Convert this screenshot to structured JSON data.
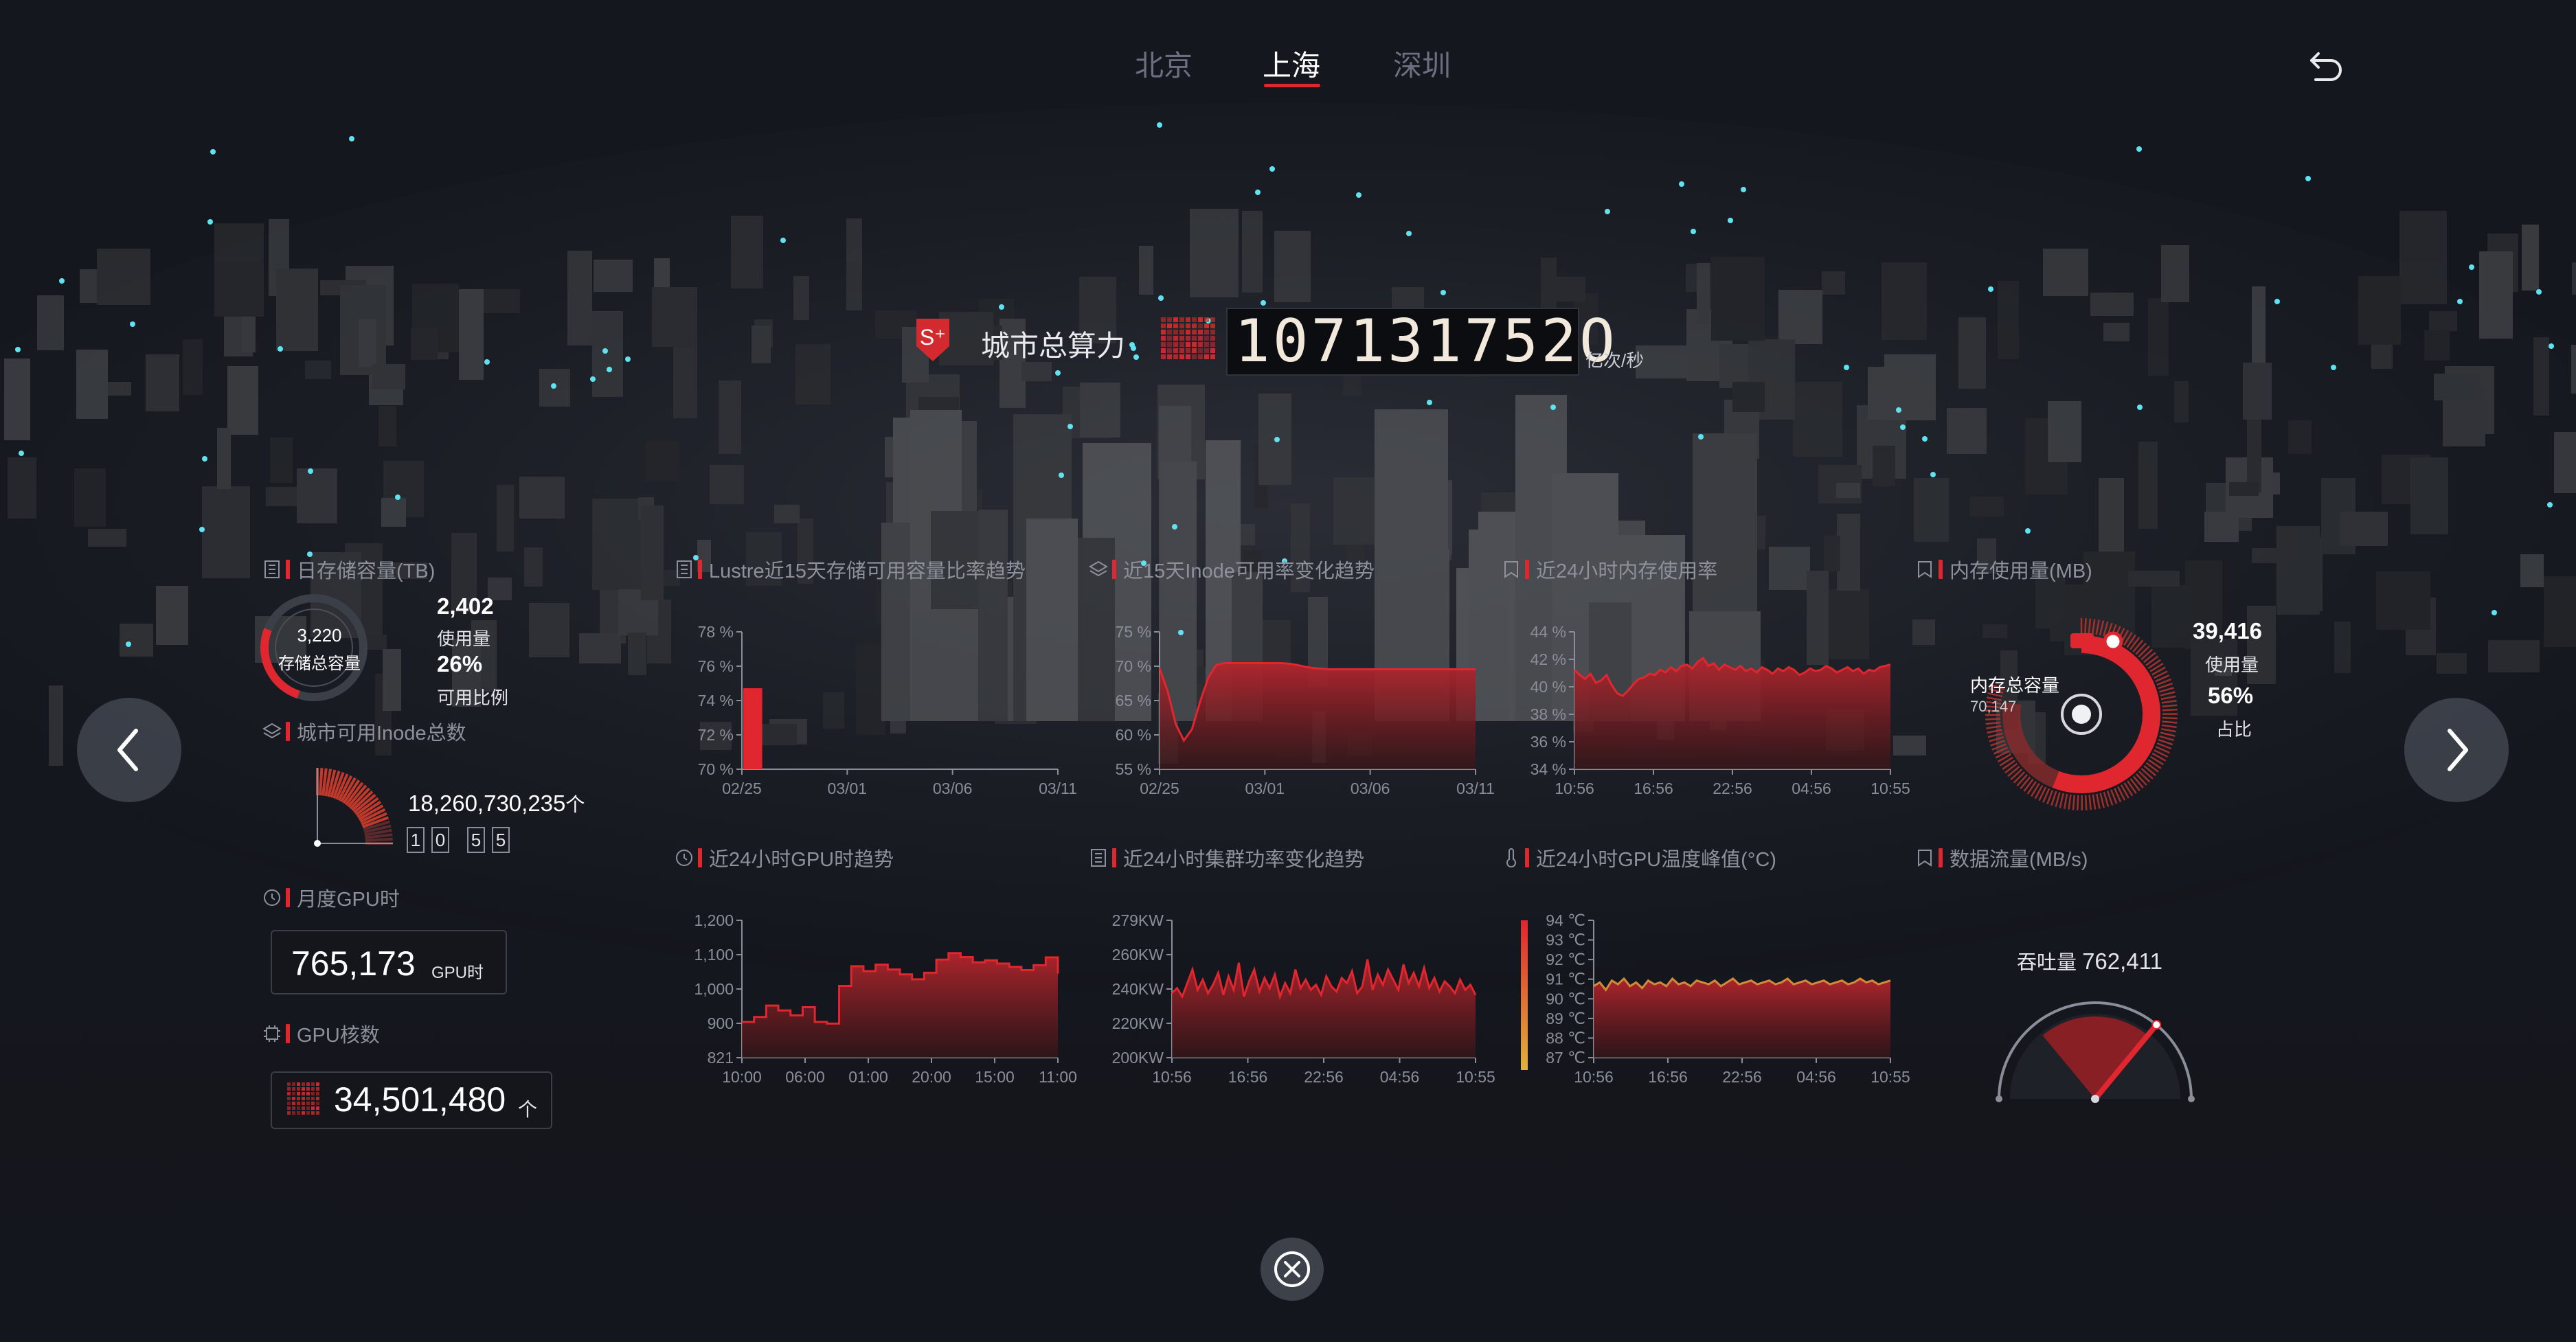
{
  "header": {
    "city_tabs": [
      "北京",
      "上海",
      "深圳"
    ],
    "active_tab": "上海"
  },
  "total_compute": {
    "label": "城市总算力",
    "badge": "S⁺",
    "value": "107131752O",
    "unit": "亿次/秒"
  },
  "storage": {
    "title": "日存储容量(TB)",
    "total_value": "3,220",
    "total_label": "存储总容量",
    "used_value": "2,402",
    "used_label": "使用量",
    "ratio_value": "26%",
    "ratio_label": "可用比例",
    "ratio_fraction": 0.26
  },
  "inode": {
    "title": "城市可用Inode总数",
    "value": "18,260,730,235",
    "unit": "个",
    "digits": [
      "1",
      "0",
      "5",
      "5"
    ]
  },
  "gpu_hours": {
    "title": "月度GPU时",
    "value": "765,173",
    "unit": "GPU时"
  },
  "gpu_cores": {
    "title": "GPU核数",
    "value": "34,501,480",
    "unit": "个"
  },
  "memory": {
    "title": "内存使用量(MB)",
    "total_label": "内存总容量",
    "total_value": "70,147",
    "used_value": "39,416",
    "used_label": "使用量",
    "ratio_value": "56%",
    "ratio_label": "占比",
    "ratio_fraction": 0.56
  },
  "throughput": {
    "title": "数据流量(MB/s)",
    "label": "吞吐量",
    "value": "762,411"
  },
  "colors": {
    "accent": "#e0262e",
    "bar_fill": "#8c1d24",
    "bg": "#13161c",
    "rain": "#2bb7c9",
    "temp_line": "#d08a3a"
  },
  "icons": {
    "back": "return-arrow-icon",
    "prev": "chevron-left-icon",
    "next": "chevron-right-icon",
    "close": "close-circle-icon"
  },
  "chart_data": [
    {
      "id": "lustre",
      "title": "Lustre近15天存储可用容量比率趋势",
      "type": "bar",
      "x_ticks": [
        "02/25",
        "03/01",
        "03/06",
        "03/11"
      ],
      "y_ticks": [
        "78 %",
        "76 %",
        "74 %",
        "72 %",
        "70 %"
      ],
      "ylim": [
        69,
        78.5
      ],
      "x_count": 15,
      "bars": [
        {
          "x": 0,
          "value": 74.6
        }
      ]
    },
    {
      "id": "inode_trend",
      "title": "近15天Inode可用率变化趋势",
      "type": "area",
      "x_ticks": [
        "02/25",
        "03/01",
        "03/06",
        "03/11"
      ],
      "y_ticks": [
        "75 %",
        "70 %",
        "65 %",
        "60 %",
        "55 %"
      ],
      "ylim": [
        54,
        76
      ],
      "values": [
        70.2,
        66.5,
        61.2,
        58.6,
        60.4,
        64.8,
        68.6,
        70.7,
        71.0,
        71.0,
        71.0,
        71.0,
        71.0,
        71.0,
        71.0,
        71.0,
        70.9,
        70.7,
        70.4,
        70.2,
        70.1,
        70.0,
        70.0,
        70.0,
        70.0,
        70.0,
        70.0,
        70.0,
        70.0,
        70.0,
        70.0,
        70.0,
        70.0,
        70.0,
        70.0,
        70.0,
        70.0,
        70.0,
        70.0,
        70.0
      ]
    },
    {
      "id": "mem24",
      "title": "近24小时内存使用率",
      "type": "area",
      "x_ticks": [
        "10:56",
        "16:56",
        "22:56",
        "04:56",
        "10:55"
      ],
      "y_ticks": [
        "44 %",
        "42 %",
        "40 %",
        "38 %",
        "36 %",
        "34 %"
      ],
      "ylim": [
        34,
        44.5
      ],
      "values": [
        41.6,
        41.2,
        40.9,
        41.3,
        40.6,
        40.8,
        41.2,
        40.4,
        39.8,
        39.6,
        40.0,
        40.5,
        40.9,
        41.0,
        41.3,
        41.2,
        41.6,
        41.4,
        41.8,
        41.5,
        41.9,
        42.0,
        41.7,
        42.2,
        42.5,
        41.9,
        42.1,
        41.6,
        42.0,
        41.8,
        41.6,
        41.9,
        41.5,
        41.7,
        41.4,
        41.8,
        41.6,
        41.3,
        41.7,
        41.5,
        41.8,
        41.6,
        41.2,
        41.4,
        41.7,
        41.5,
        41.6,
        41.9,
        41.7,
        41.4,
        41.6,
        41.8,
        41.5,
        41.7,
        41.3,
        41.6,
        41.5,
        41.8,
        41.9,
        42.0
      ]
    },
    {
      "id": "gpu_hours_24",
      "title": "近24小时GPU时趋势",
      "type": "area",
      "step": true,
      "x_ticks": [
        "10:00",
        "06:00",
        "01:00",
        "20:00",
        "15:00",
        "11:00"
      ],
      "y_ticks": [
        "1,200",
        "1,100",
        "1,000",
        "900",
        "821"
      ],
      "ylim": [
        821,
        1240
      ],
      "values": [
        930,
        945,
        980,
        965,
        950,
        975,
        930,
        925,
        1040,
        1100,
        1085,
        1105,
        1090,
        1075,
        1060,
        1080,
        1120,
        1140,
        1128,
        1112,
        1118,
        1108,
        1098,
        1088,
        1103,
        1127,
        1077
      ]
    },
    {
      "id": "power24",
      "title": "近24小时集群功率变化趋势",
      "type": "area",
      "x_ticks": [
        "10:56",
        "16:56",
        "22:56",
        "04:56",
        "10:55"
      ],
      "y_ticks": [
        "279KW",
        "260KW",
        "240KW",
        "220KW",
        "200KW"
      ],
      "ylim": [
        200,
        281
      ],
      "values": [
        238,
        241,
        236,
        244,
        252,
        240,
        246,
        238,
        243,
        250,
        237,
        248,
        240,
        256,
        236,
        245,
        252,
        239,
        247,
        241,
        249,
        236,
        244,
        238,
        252,
        241,
        246,
        240,
        243,
        237,
        248,
        242,
        239,
        247,
        244,
        251,
        238,
        242,
        258,
        240,
        249,
        243,
        252,
        246,
        240,
        255,
        244,
        250,
        242,
        253,
        241,
        247,
        239,
        245,
        242,
        238,
        246,
        240,
        243,
        237
      ]
    },
    {
      "id": "gputemp24",
      "title": "近24小时GPU温度峰值(°C)",
      "type": "area",
      "x_ticks": [
        "10:56",
        "16:56",
        "22:56",
        "04:56",
        "10:55"
      ],
      "y_ticks": [
        "94 ℃",
        "93 ℃",
        "92 ℃",
        "91 ℃",
        "90 ℃",
        "89 ℃",
        "88 ℃",
        "87 ℃"
      ],
      "ylim": [
        87,
        94.3
      ],
      "values": [
        90.8,
        91.0,
        90.6,
        91.1,
        90.9,
        91.2,
        90.8,
        91.0,
        90.7,
        91.1,
        90.9,
        91.0,
        90.8,
        91.2,
        90.9,
        91.0,
        90.8,
        91.1,
        91.0,
        90.9,
        91.1,
        90.8,
        91.0,
        91.2,
        90.9,
        91.0,
        91.1,
        90.9,
        91.0,
        91.1,
        90.9,
        91.0,
        91.2,
        90.9,
        91.0,
        91.1,
        90.9,
        91.0,
        91.1,
        90.9,
        91.0,
        91.1,
        90.9,
        91.0,
        91.2,
        91.0,
        91.1,
        90.9,
        91.0,
        91.1
      ]
    }
  ]
}
